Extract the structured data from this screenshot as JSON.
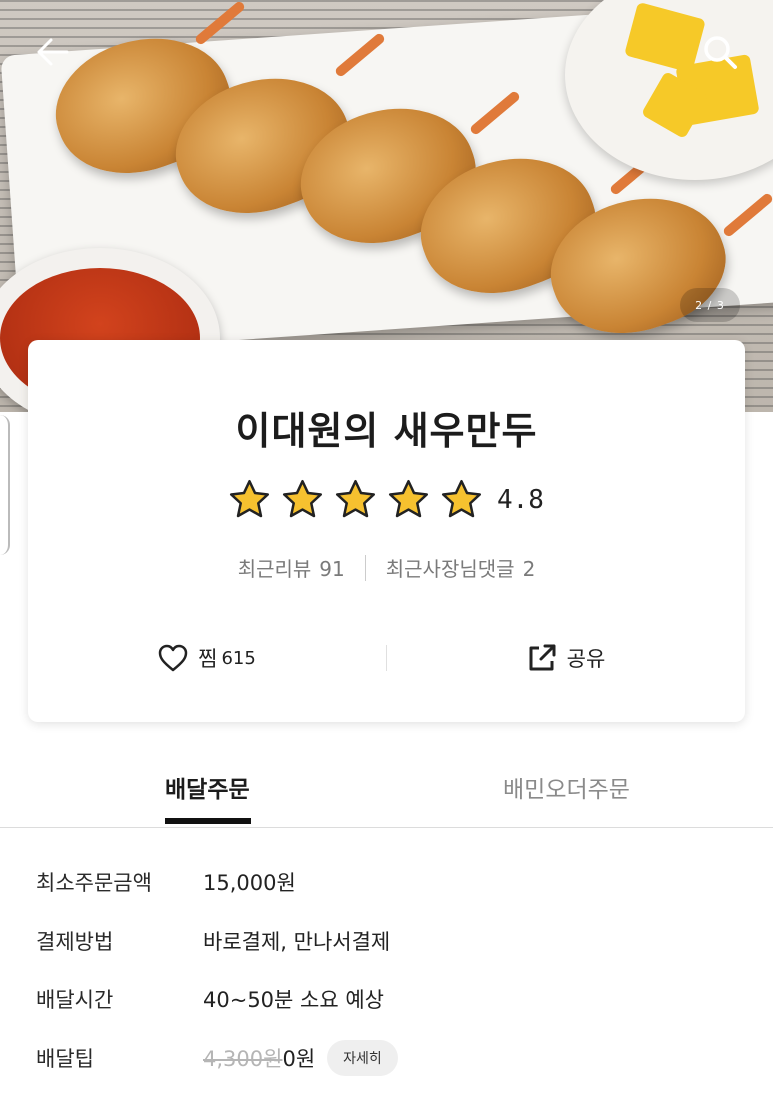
{
  "hero": {
    "page_indicator": "2 / 3",
    "back_icon": "arrow-left-icon",
    "search_icon": "search-icon"
  },
  "store": {
    "name": "이대원의 새우만두",
    "rating": "4.8",
    "stars_filled": 5,
    "star_color": "#f6c12f"
  },
  "reviews": {
    "recent_reviews_label": "최근리뷰",
    "recent_reviews_count": "91",
    "owner_comments_label": "최근사장님댓글",
    "owner_comments_count": "2"
  },
  "actions": {
    "like_label": "찜",
    "like_count": "615",
    "share_label": "공유"
  },
  "tabs": [
    {
      "label": "배달주문",
      "active": true
    },
    {
      "label": "배민오더주문",
      "active": false
    }
  ],
  "details": {
    "min_order_label": "최소주문금액",
    "min_order_value": "15,000원",
    "payment_label": "결제방법",
    "payment_value": "바로결제, 만나서결제",
    "delivery_time_label": "배달시간",
    "delivery_time_value": "40~50분 소요 예상",
    "delivery_tip_label": "배달팁",
    "delivery_tip_old": "4,300원",
    "delivery_tip_new": "0원",
    "detail_button": "자세히"
  }
}
